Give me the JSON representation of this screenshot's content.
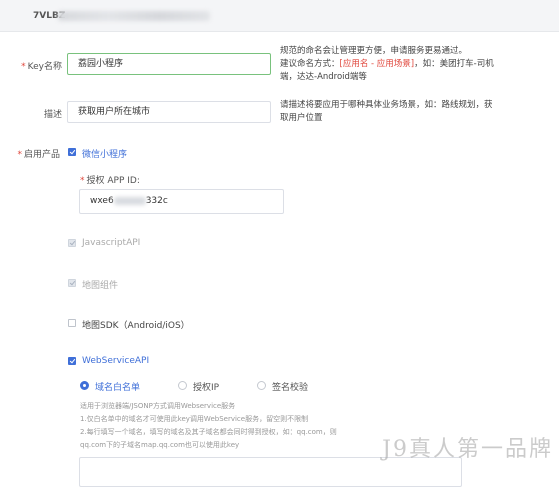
{
  "header": {
    "key_prefix": "7VLBZ"
  },
  "form": {
    "key_name": {
      "label": "Key名称",
      "value": "荔园小程序",
      "hint_line1": "规范的命名会让管理更方便，申请服务更易通过。",
      "hint_line2_prefix": "建议命名方式：",
      "hint_line2_em": "[应用名 - 应用场景]",
      "hint_line2_suffix": "，如：美团打车-司机",
      "hint_line3": "端，达达-Android端等"
    },
    "description": {
      "label": "描述",
      "value": "获取用户所在城市",
      "hint_line1": "请描述将要应用于哪种具体业务场景，如：路线规划，获",
      "hint_line2": "取用户位置"
    },
    "products": {
      "label": "启用产品",
      "wechat_miniprogram": "微信小程序",
      "appid_label": "授权 APP ID:",
      "appid_value_prefix": "wxe6",
      "appid_value_suffix": "332c",
      "javascript_api": "JavascriptAPI",
      "map_component": "地图组件",
      "map_sdk": "地图SDK（Android/iOS）",
      "webservice_api": "WebServiceAPI"
    },
    "webservice": {
      "radio_domain_whitelist": "域名白名单",
      "radio_auth_ip": "授权IP",
      "radio_signature": "签名校验",
      "note_line1": "适用于浏览器端/JSONP方式调用Webservice服务",
      "note_line2": "1.仅白名单中的域名才可使用此key调用WebService服务，留空则不限制",
      "note_line3": "2.每行填写一个域名，填写的域名及其子域名都会同时得到授权，如：qq.com，则",
      "note_line4": "qq.com下的子域名map.qq.com也可以使用此key"
    }
  },
  "watermark": "J9真人第一品牌",
  "colors": {
    "accent": "#3f6fd8",
    "required": "#e0473c",
    "focus_border": "#79c27d"
  }
}
